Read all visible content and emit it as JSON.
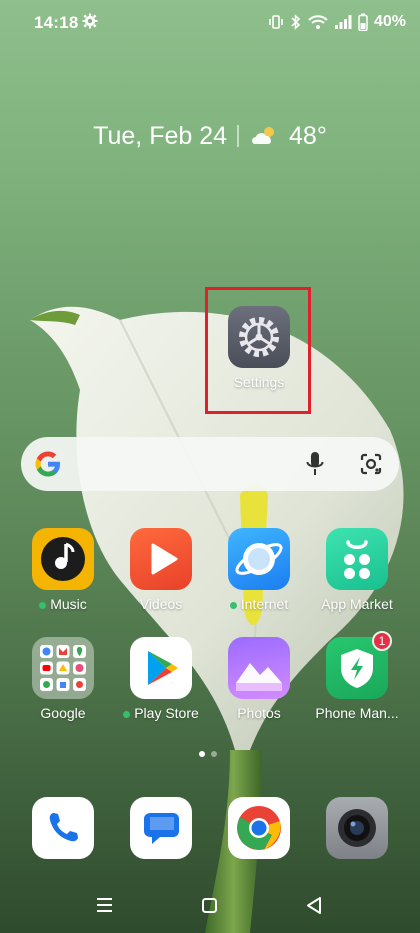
{
  "status_bar": {
    "time": "14:18",
    "battery": "40%"
  },
  "widget": {
    "date": "Tue, Feb 24",
    "temperature": "48°"
  },
  "shortcut": {
    "label": "Settings"
  },
  "apps_row1": [
    {
      "label": "Music",
      "new_dot": true
    },
    {
      "label": "Videos",
      "new_dot": false
    },
    {
      "label": "Internet",
      "new_dot": true
    },
    {
      "label": "App Market",
      "new_dot": false
    }
  ],
  "apps_row2": [
    {
      "label": "Google",
      "new_dot": false
    },
    {
      "label": "Play Store",
      "new_dot": true
    },
    {
      "label": "Photos",
      "new_dot": false
    },
    {
      "label": "Phone Man...",
      "new_dot": false,
      "badge": "1"
    }
  ],
  "dock": [
    "phone-icon",
    "messages-icon",
    "chrome-icon",
    "camera-icon"
  ],
  "colors": {
    "highlight": "#e0202a",
    "new_dot": "#35c06b",
    "badge": "#e5304a"
  }
}
